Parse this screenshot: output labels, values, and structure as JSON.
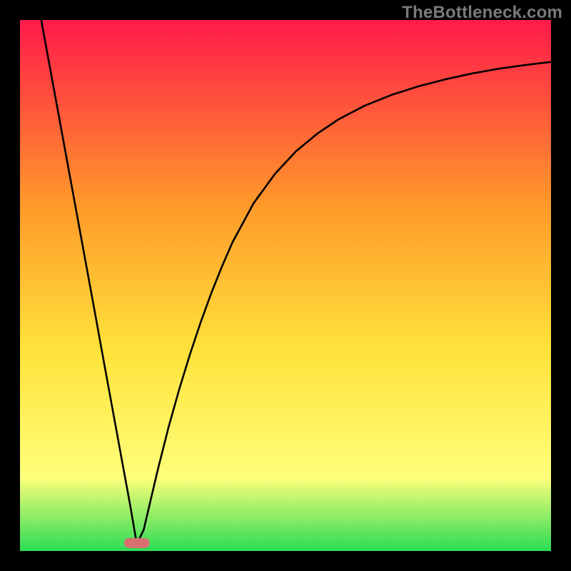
{
  "watermark": "TheBottleneck.com",
  "chart_data": {
    "type": "line",
    "title": "",
    "xlabel": "",
    "ylabel": "",
    "xlim": [
      0,
      100
    ],
    "ylim": [
      0,
      100
    ],
    "grid": false,
    "legend": false,
    "background_gradient": {
      "top_color": "#ff1a4a",
      "mid1_color": "#ff9a2a",
      "mid2_color": "#ffe23a",
      "mid3_color": "#ffff7a",
      "bottom_color": "#2bdc55"
    },
    "marker": {
      "shape": "capsule",
      "center_x": 22,
      "center_y": 1.5,
      "fill": "#d9706f"
    },
    "series": [
      {
        "name": "curve",
        "x": [
          4.0,
          6.0,
          8.0,
          10.0,
          12.0,
          14.0,
          16.0,
          18.0,
          19.3,
          20.7,
          22.0,
          23.3,
          24.7,
          26.0,
          28.0,
          30.0,
          32.0,
          34.0,
          36.0,
          38.0,
          40.0,
          44.0,
          48.0,
          52.0,
          56.0,
          60.0,
          65.0,
          70.0,
          75.0,
          80.0,
          85.0,
          90.0,
          95.0,
          100.0
        ],
        "y": [
          100.0,
          89.1,
          78.2,
          67.3,
          56.4,
          45.5,
          34.5,
          23.6,
          16.5,
          8.9,
          1.3,
          4.0,
          10.0,
          15.5,
          23.4,
          30.5,
          37.0,
          43.0,
          48.5,
          53.5,
          58.1,
          65.5,
          71.0,
          75.3,
          78.6,
          81.3,
          83.9,
          85.9,
          87.5,
          88.8,
          89.9,
          90.8,
          91.5,
          92.1
        ]
      }
    ]
  }
}
